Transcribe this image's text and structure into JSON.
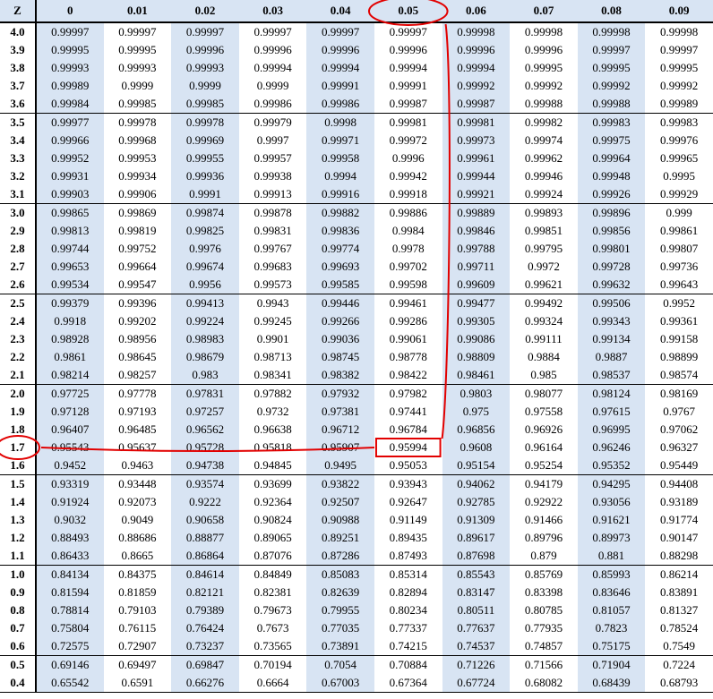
{
  "headers": [
    "Z",
    "0",
    "0.01",
    "0.02",
    "0.03",
    "0.04",
    "0.05",
    "0.06",
    "0.07",
    "0.08",
    "0.09"
  ],
  "groups": [
    [
      {
        "z": "4.0",
        "v": [
          "0.99997",
          "0.99997",
          "0.99997",
          "0.99997",
          "0.99997",
          "0.99997",
          "0.99998",
          "0.99998",
          "0.99998",
          "0.99998"
        ]
      },
      {
        "z": "3.9",
        "v": [
          "0.99995",
          "0.99995",
          "0.99996",
          "0.99996",
          "0.99996",
          "0.99996",
          "0.99996",
          "0.99996",
          "0.99997",
          "0.99997"
        ]
      },
      {
        "z": "3.8",
        "v": [
          "0.99993",
          "0.99993",
          "0.99993",
          "0.99994",
          "0.99994",
          "0.99994",
          "0.99994",
          "0.99995",
          "0.99995",
          "0.99995"
        ]
      },
      {
        "z": "3.7",
        "v": [
          "0.99989",
          "0.9999",
          "0.9999",
          "0.9999",
          "0.99991",
          "0.99991",
          "0.99992",
          "0.99992",
          "0.99992",
          "0.99992"
        ]
      },
      {
        "z": "3.6",
        "v": [
          "0.99984",
          "0.99985",
          "0.99985",
          "0.99986",
          "0.99986",
          "0.99987",
          "0.99987",
          "0.99988",
          "0.99988",
          "0.99989"
        ]
      }
    ],
    [
      {
        "z": "3.5",
        "v": [
          "0.99977",
          "0.99978",
          "0.99978",
          "0.99979",
          "0.9998",
          "0.99981",
          "0.99981",
          "0.99982",
          "0.99983",
          "0.99983"
        ]
      },
      {
        "z": "3.4",
        "v": [
          "0.99966",
          "0.99968",
          "0.99969",
          "0.9997",
          "0.99971",
          "0.99972",
          "0.99973",
          "0.99974",
          "0.99975",
          "0.99976"
        ]
      },
      {
        "z": "3.3",
        "v": [
          "0.99952",
          "0.99953",
          "0.99955",
          "0.99957",
          "0.99958",
          "0.9996",
          "0.99961",
          "0.99962",
          "0.99964",
          "0.99965"
        ]
      },
      {
        "z": "3.2",
        "v": [
          "0.99931",
          "0.99934",
          "0.99936",
          "0.99938",
          "0.9994",
          "0.99942",
          "0.99944",
          "0.99946",
          "0.99948",
          "0.9995"
        ]
      },
      {
        "z": "3.1",
        "v": [
          "0.99903",
          "0.99906",
          "0.9991",
          "0.99913",
          "0.99916",
          "0.99918",
          "0.99921",
          "0.99924",
          "0.99926",
          "0.99929"
        ]
      }
    ],
    [
      {
        "z": "3.0",
        "v": [
          "0.99865",
          "0.99869",
          "0.99874",
          "0.99878",
          "0.99882",
          "0.99886",
          "0.99889",
          "0.99893",
          "0.99896",
          "0.999"
        ]
      },
      {
        "z": "2.9",
        "v": [
          "0.99813",
          "0.99819",
          "0.99825",
          "0.99831",
          "0.99836",
          "0.9984",
          "0.99846",
          "0.99851",
          "0.99856",
          "0.99861"
        ]
      },
      {
        "z": "2.8",
        "v": [
          "0.99744",
          "0.99752",
          "0.9976",
          "0.99767",
          "0.99774",
          "0.9978",
          "0.99788",
          "0.99795",
          "0.99801",
          "0.99807"
        ]
      },
      {
        "z": "2.7",
        "v": [
          "0.99653",
          "0.99664",
          "0.99674",
          "0.99683",
          "0.99693",
          "0.99702",
          "0.99711",
          "0.9972",
          "0.99728",
          "0.99736"
        ]
      },
      {
        "z": "2.6",
        "v": [
          "0.99534",
          "0.99547",
          "0.9956",
          "0.99573",
          "0.99585",
          "0.99598",
          "0.99609",
          "0.99621",
          "0.99632",
          "0.99643"
        ]
      }
    ],
    [
      {
        "z": "2.5",
        "v": [
          "0.99379",
          "0.99396",
          "0.99413",
          "0.9943",
          "0.99446",
          "0.99461",
          "0.99477",
          "0.99492",
          "0.99506",
          "0.9952"
        ]
      },
      {
        "z": "2.4",
        "v": [
          "0.9918",
          "0.99202",
          "0.99224",
          "0.99245",
          "0.99266",
          "0.99286",
          "0.99305",
          "0.99324",
          "0.99343",
          "0.99361"
        ]
      },
      {
        "z": "2.3",
        "v": [
          "0.98928",
          "0.98956",
          "0.98983",
          "0.9901",
          "0.99036",
          "0.99061",
          "0.99086",
          "0.99111",
          "0.99134",
          "0.99158"
        ]
      },
      {
        "z": "2.2",
        "v": [
          "0.9861",
          "0.98645",
          "0.98679",
          "0.98713",
          "0.98745",
          "0.98778",
          "0.98809",
          "0.9884",
          "0.9887",
          "0.98899"
        ]
      },
      {
        "z": "2.1",
        "v": [
          "0.98214",
          "0.98257",
          "0.983",
          "0.98341",
          "0.98382",
          "0.98422",
          "0.98461",
          "0.985",
          "0.98537",
          "0.98574"
        ]
      }
    ],
    [
      {
        "z": "2.0",
        "v": [
          "0.97725",
          "0.97778",
          "0.97831",
          "0.97882",
          "0.97932",
          "0.97982",
          "0.9803",
          "0.98077",
          "0.98124",
          "0.98169"
        ]
      },
      {
        "z": "1.9",
        "v": [
          "0.97128",
          "0.97193",
          "0.97257",
          "0.9732",
          "0.97381",
          "0.97441",
          "0.975",
          "0.97558",
          "0.97615",
          "0.9767"
        ]
      },
      {
        "z": "1.8",
        "v": [
          "0.96407",
          "0.96485",
          "0.96562",
          "0.96638",
          "0.96712",
          "0.96784",
          "0.96856",
          "0.96926",
          "0.96995",
          "0.97062"
        ]
      },
      {
        "z": "1.7",
        "v": [
          "0.95543",
          "0.95637",
          "0.95728",
          "0.95818",
          "0.95907",
          "0.95994",
          "0.9608",
          "0.96164",
          "0.96246",
          "0.96327"
        ]
      },
      {
        "z": "1.6",
        "v": [
          "0.9452",
          "0.9463",
          "0.94738",
          "0.94845",
          "0.9495",
          "0.95053",
          "0.95154",
          "0.95254",
          "0.95352",
          "0.95449"
        ]
      }
    ],
    [
      {
        "z": "1.5",
        "v": [
          "0.93319",
          "0.93448",
          "0.93574",
          "0.93699",
          "0.93822",
          "0.93943",
          "0.94062",
          "0.94179",
          "0.94295",
          "0.94408"
        ]
      },
      {
        "z": "1.4",
        "v": [
          "0.91924",
          "0.92073",
          "0.9222",
          "0.92364",
          "0.92507",
          "0.92647",
          "0.92785",
          "0.92922",
          "0.93056",
          "0.93189"
        ]
      },
      {
        "z": "1.3",
        "v": [
          "0.9032",
          "0.9049",
          "0.90658",
          "0.90824",
          "0.90988",
          "0.91149",
          "0.91309",
          "0.91466",
          "0.91621",
          "0.91774"
        ]
      },
      {
        "z": "1.2",
        "v": [
          "0.88493",
          "0.88686",
          "0.88877",
          "0.89065",
          "0.89251",
          "0.89435",
          "0.89617",
          "0.89796",
          "0.89973",
          "0.90147"
        ]
      },
      {
        "z": "1.1",
        "v": [
          "0.86433",
          "0.8665",
          "0.86864",
          "0.87076",
          "0.87286",
          "0.87493",
          "0.87698",
          "0.879",
          "0.881",
          "0.88298"
        ]
      }
    ],
    [
      {
        "z": "1.0",
        "v": [
          "0.84134",
          "0.84375",
          "0.84614",
          "0.84849",
          "0.85083",
          "0.85314",
          "0.85543",
          "0.85769",
          "0.85993",
          "0.86214"
        ]
      },
      {
        "z": "0.9",
        "v": [
          "0.81594",
          "0.81859",
          "0.82121",
          "0.82381",
          "0.82639",
          "0.82894",
          "0.83147",
          "0.83398",
          "0.83646",
          "0.83891"
        ]
      },
      {
        "z": "0.8",
        "v": [
          "0.78814",
          "0.79103",
          "0.79389",
          "0.79673",
          "0.79955",
          "0.80234",
          "0.80511",
          "0.80785",
          "0.81057",
          "0.81327"
        ]
      },
      {
        "z": "0.7",
        "v": [
          "0.75804",
          "0.76115",
          "0.76424",
          "0.7673",
          "0.77035",
          "0.77337",
          "0.77637",
          "0.77935",
          "0.7823",
          "0.78524"
        ]
      },
      {
        "z": "0.6",
        "v": [
          "0.72575",
          "0.72907",
          "0.73237",
          "0.73565",
          "0.73891",
          "0.74215",
          "0.74537",
          "0.74857",
          "0.75175",
          "0.7549"
        ]
      }
    ],
    [
      {
        "z": "0.5",
        "v": [
          "0.69146",
          "0.69497",
          "0.69847",
          "0.70194",
          "0.7054",
          "0.70884",
          "0.71226",
          "0.71566",
          "0.71904",
          "0.7224"
        ]
      },
      {
        "z": "0.4",
        "v": [
          "0.65542",
          "0.6591",
          "0.66276",
          "0.6664",
          "0.67003",
          "0.67364",
          "0.67724",
          "0.68082",
          "0.68439",
          "0.68793"
        ]
      }
    ]
  ],
  "markers": {
    "col_header_circle": "0.05",
    "row_label_circle": "1.7",
    "intersection_box": "0.95994"
  }
}
